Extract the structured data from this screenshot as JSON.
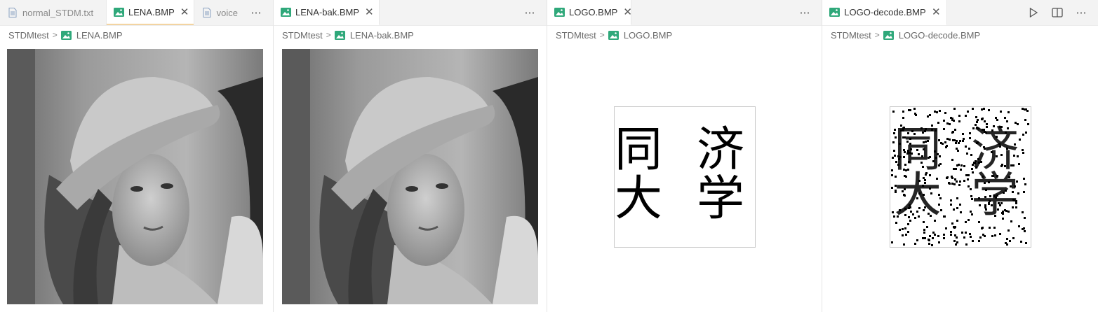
{
  "groups": [
    {
      "tabs": [
        {
          "label": "normal_STDM.txt",
          "icon": "file-text-icon",
          "active": false
        },
        {
          "label": "LENA.BMP",
          "icon": "image-icon",
          "active": true
        },
        {
          "label": "voice",
          "icon": "file-text-icon",
          "active": false
        }
      ],
      "breadcrumb": {
        "folder": "STDMtest",
        "file": "LENA.BMP"
      },
      "image": "lena-photo"
    },
    {
      "tabs": [
        {
          "label": "LENA-bak.BMP",
          "icon": "image-icon",
          "active": true
        }
      ],
      "breadcrumb": {
        "folder": "STDMtest",
        "file": "LENA-bak.BMP"
      },
      "image": "lena-photo"
    },
    {
      "tabs": [
        {
          "label": "LOGO.BMP",
          "icon": "image-icon",
          "active": true
        }
      ],
      "breadcrumb": {
        "folder": "STDMtest",
        "file": "LOGO.BMP"
      },
      "image": "logo-bitmap",
      "logo_text": {
        "c1": "同",
        "c2": "济",
        "c3": "大",
        "c4": "学"
      }
    },
    {
      "tabs": [
        {
          "label": "LOGO-decode.BMP",
          "icon": "image-icon",
          "active": true
        }
      ],
      "breadcrumb": {
        "folder": "STDMtest",
        "file": "LOGO-decode.BMP"
      },
      "image": "decoded-logo-bitmap",
      "logo_text": {
        "c1": "同",
        "c2": "济",
        "c3": "大",
        "c4": "学"
      }
    }
  ],
  "actions": {
    "more": "more-actions-icon",
    "run": "run-icon",
    "split": "split-editor-icon"
  },
  "colors": {
    "image_icon": "#2fa87a",
    "tab_bar": "#f3f3f3",
    "active_tab": "#ffffff",
    "focus_accent": "#e5a43a"
  }
}
